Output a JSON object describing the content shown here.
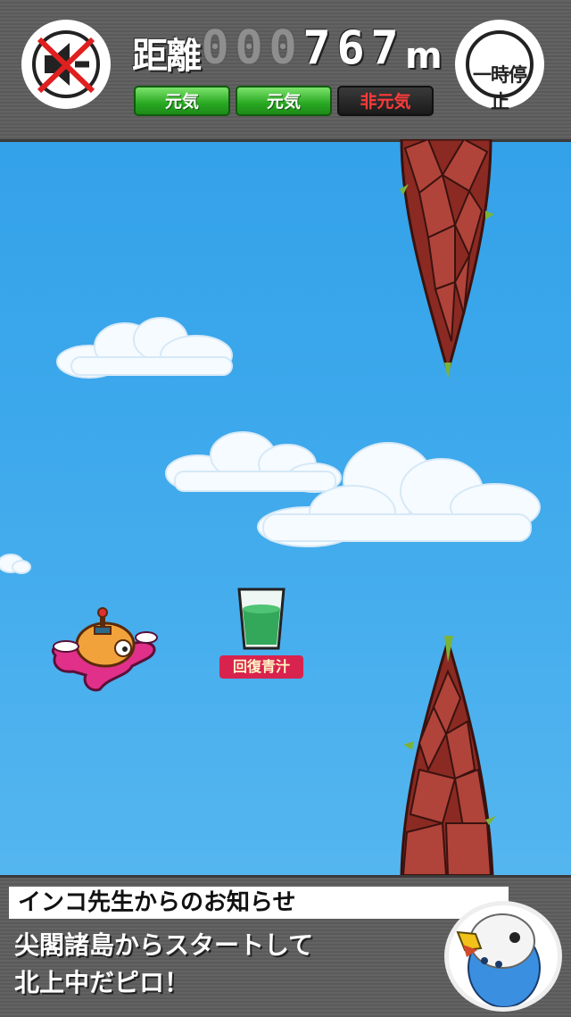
{
  "hud": {
    "mute_icon": "speaker-muted-icon",
    "distance_label": "距離",
    "distance_digits": [
      "0",
      "0",
      "0",
      "7",
      "6",
      "7"
    ],
    "distance_unit": "m",
    "health": [
      {
        "label": "元気",
        "state": "on"
      },
      {
        "label": "元気",
        "state": "on"
      },
      {
        "label": "非元気",
        "state": "off"
      }
    ],
    "pause_label": "一時停止"
  },
  "item": {
    "label": "回復青汁",
    "icon": "green-juice-glass-icon"
  },
  "notice": {
    "title": "インコ先生からのお知らせ",
    "line1": "尖閣諸島からスタートして",
    "line2": "北上中だピロ！",
    "avatar_icon": "budgie-avatar-icon"
  },
  "colors": {
    "sky": "#3ea9ec",
    "health_on": "#29a822",
    "health_off_text": "#ff3a3a",
    "item_badge": "#d8234e"
  }
}
